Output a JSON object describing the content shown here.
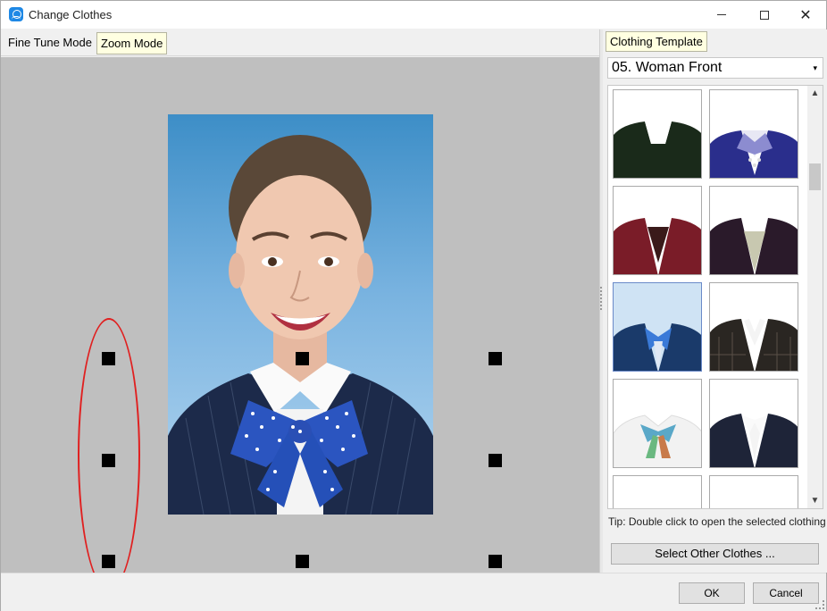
{
  "window": {
    "title": "Change Clothes",
    "minimize_label": "",
    "close_label": "✕"
  },
  "modes": {
    "fine_tune": "Fine Tune Mode",
    "zoom": "Zoom Mode"
  },
  "template_panel": {
    "tab_label": "Clothing Template",
    "category": "05. Woman Front",
    "dropdown_arrow": "▾",
    "scroll_up": "▲",
    "scroll_down": "▼",
    "tip": "Tip: Double click to open the selected clothing template",
    "select_other_label": "Select Other Clothes ..."
  },
  "footer": {
    "ok_label": "OK",
    "cancel_label": "Cancel"
  },
  "colors": {
    "accent_app_icon": "#1e88e5",
    "highlight_tab": "#ffffe1",
    "annotation_ellipse": "#e02020",
    "canvas_background": "#bfbfbf"
  },
  "icons": {
    "app": "user-camera-icon",
    "minimize": "minimize-icon",
    "maximize": "maximize-icon",
    "close": "close-icon",
    "dropdown": "chevron-down-icon"
  }
}
